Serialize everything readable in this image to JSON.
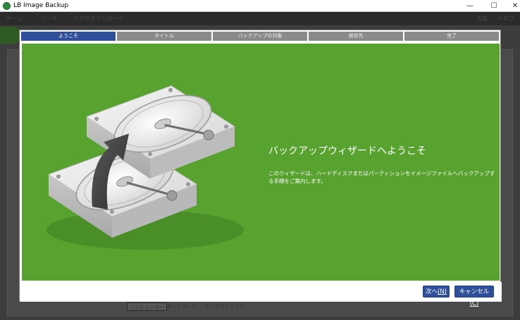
{
  "window": {
    "title": "LB Image Backup",
    "minimize_glyph": "—",
    "maximize_glyph": "☐",
    "close_glyph": "✕"
  },
  "background": {
    "menu": [
      "ホーム",
      "ツール",
      "ログのダウンロード",
      "言語",
      "ヘルプ"
    ],
    "bottom_tabs": [
      "コンピューター",
      "ネットワーク",
      "ディスクドライブ"
    ]
  },
  "wizard": {
    "steps": [
      {
        "label": "ようこそ",
        "active": true
      },
      {
        "label": "タイトル",
        "active": false
      },
      {
        "label": "バックアップの対象",
        "active": false
      },
      {
        "label": "保存先",
        "active": false
      },
      {
        "label": "完了",
        "active": false
      }
    ],
    "heading": "バックアップウィザードへようこそ",
    "description": "このウィザードは、ハードディスクまたはパーティションをイメージファイルへバックアップする手順をご案内します。",
    "buttons": {
      "next_label": "次へ",
      "next_hotkey": "(N)",
      "cancel_label": "キャンセル",
      "cancel_hotkey": "(C)"
    },
    "illustration_icon": "hard-drives-backup-icon"
  },
  "colors": {
    "accent": "#2f4f9a",
    "content_green": "#58a22f",
    "step_inactive": "#8a8a8a"
  }
}
